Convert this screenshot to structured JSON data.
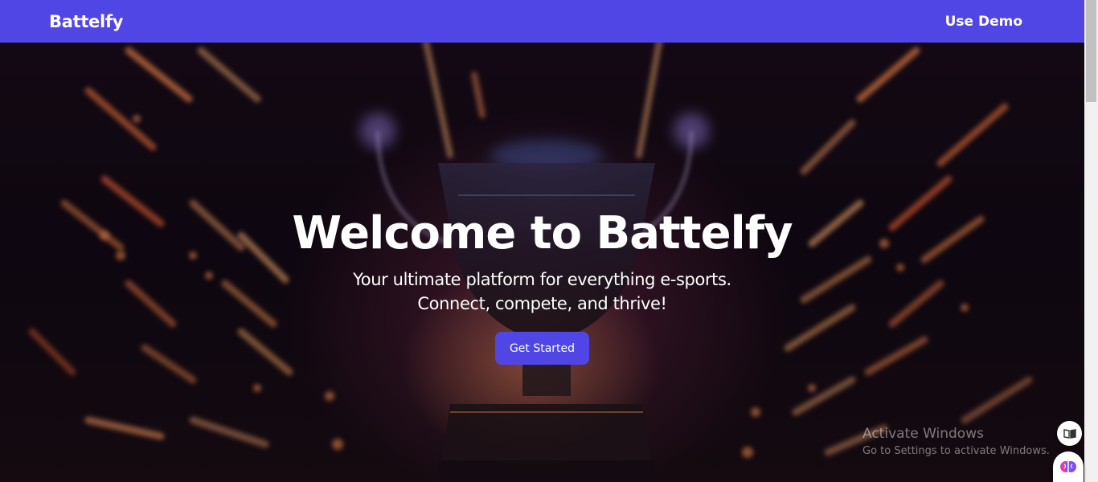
{
  "navbar": {
    "brand": "Battelfy",
    "demo_link": "Use Demo",
    "background_color": "#4f46e5"
  },
  "hero": {
    "title": "Welcome to Battelfy",
    "subtitle": "Your ultimate platform for everything e-sports. Connect, compete, and thrive!",
    "cta_label": "Get Started",
    "cta_color": "#4f46e5",
    "background_image": "trophy-neon-image"
  },
  "watermark": {
    "title": "Activate Windows",
    "subtitle": "Go to Settings to activate Windows."
  },
  "floating": {
    "reader_icon": "immersive-reader-icon",
    "assistant_icon": "brain-assistant-icon"
  }
}
